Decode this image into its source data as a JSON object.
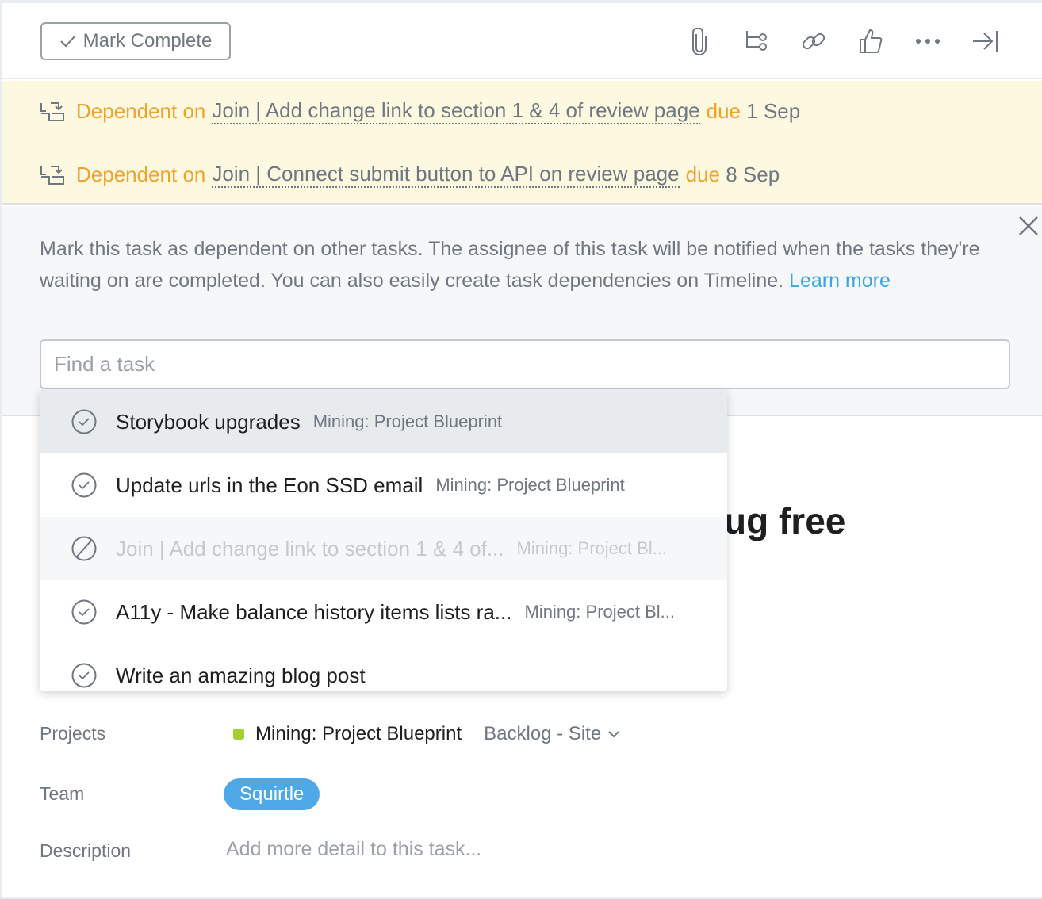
{
  "toolbar": {
    "mark_complete": "Mark Complete",
    "icons": [
      "paperclip-icon",
      "subtask-icon",
      "link-icon",
      "thumbs-up-icon",
      "more-icon",
      "close-pane-icon"
    ]
  },
  "dependencies": [
    {
      "prefix": "Dependent on",
      "task": "Join | Add change link to section 1 & 4 of review page",
      "due_label": "due",
      "due": "1 Sep"
    },
    {
      "prefix": "Dependent on",
      "task": "Join | Connect submit button to API on review page",
      "due_label": "due",
      "due": "8 Sep"
    }
  ],
  "info": {
    "text": "Mark this task as dependent on other tasks. The assignee of this task will be notified when the tasks they're waiting on are completed. You can also easily create task dependencies on Timeline.",
    "link": "Learn more"
  },
  "search": {
    "placeholder": "Find a task",
    "value": ""
  },
  "results": [
    {
      "name": "Storybook upgrades",
      "project": "Mining: Project Blueprint"
    },
    {
      "name": "Update urls in the Eon SSD email",
      "project": "Mining: Project Blueprint"
    },
    {
      "name": "Join | Add change link to section 1 & 4 of...",
      "project": "Mining: Project Bl..."
    },
    {
      "name": "A11y - Make balance history items lists ra...",
      "project": "Mining: Project Bl..."
    },
    {
      "name": "Write an amazing blog post",
      "project": ""
    }
  ],
  "task": {
    "title_visible": "ug free"
  },
  "fields": {
    "projects_label": "Projects",
    "project": "Mining: Project Blueprint",
    "section": "Backlog - Site",
    "team_label": "Team",
    "team": "Squirtle",
    "description_label": "Description",
    "description_placeholder": "Add more detail to this task..."
  },
  "colors": {
    "accent": "#f1a22a",
    "link": "#37a6e8",
    "team": "#4ea8e8",
    "project": "#a4cf30"
  }
}
